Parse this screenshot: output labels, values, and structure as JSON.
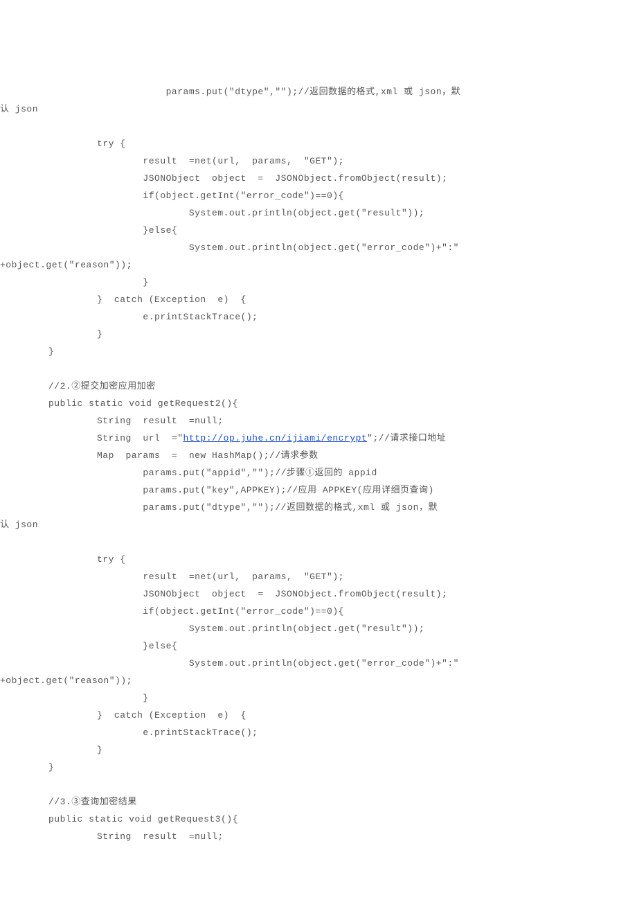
{
  "lines": {
    "l1a": "            params.put(\"dtype\",\"\");//返回数据的格式,xml 或 json，默",
    "l1b": "认 json",
    "l2": " ",
    "l3": "try {",
    "l4": "        result  =net(url,  params,  \"GET\");",
    "l5": "        JSONObject  object  =  JSONObject.fromObject(result);",
    "l6": "        if(object.getInt(\"error_code\")==0){",
    "l7": "                System.out.println(object.get(\"result\"));",
    "l8": "        }else{",
    "l9a": "                System.out.println(object.get(\"error_code\")+\":\"",
    "l9b": "+object.get(\"reason\"));",
    "l10": "        }",
    "l11": "}  catch (Exception  e)  {",
    "l12": "        e.printStackTrace();",
    "l13": "}",
    "l14": "}",
    "l15": " ",
    "l16": "//2.②提交加密应用加密",
    "l17": "public static void getRequest2(){",
    "l18": "String  result  =null;",
    "l19a": "String  url  =\"",
    "l19url": "http://op.juhe.cn/ijiami/encrypt",
    "l19b": "\";//请求接口地址",
    "l20": "Map  params  =  new HashMap();//请求参数",
    "l21": "        params.put(\"appid\",\"\");//步骤①返回的 appid",
    "l22": "        params.put(\"key\",APPKEY);//应用 APPKEY(应用详细页查询)",
    "l23a": "        params.put(\"dtype\",\"\");//返回数据的格式,xml 或 json，默",
    "l23b": "认 json",
    "l24": " ",
    "l25": "try {",
    "l26": "        result  =net(url,  params,  \"GET\");",
    "l27": "        JSONObject  object  =  JSONObject.fromObject(result);",
    "l28": "        if(object.getInt(\"error_code\")==0){",
    "l29": "                System.out.println(object.get(\"result\"));",
    "l30": "        }else{",
    "l31a": "                System.out.println(object.get(\"error_code\")+\":\"",
    "l31b": "+object.get(\"reason\"));",
    "l32": "        }",
    "l33": "}  catch (Exception  e)  {",
    "l34": "        e.printStackTrace();",
    "l35": "}",
    "l36": "}",
    "l37": " ",
    "l38": "//3.③查询加密结果",
    "l39": "public static void getRequest3(){",
    "l40": "String  result  =null;"
  }
}
